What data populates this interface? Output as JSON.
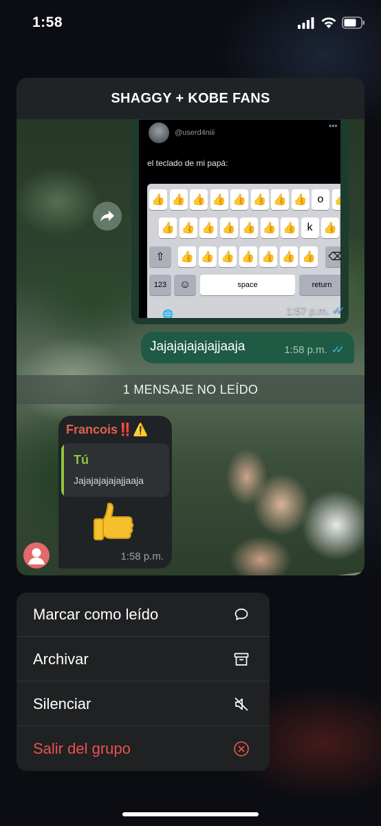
{
  "status_bar": {
    "time": "1:58"
  },
  "chat": {
    "title": "SHAGGY + KOBE FANS",
    "image_message": {
      "tweet_user": "@userd4niii",
      "tweet_text": "el teclado de mi papá:",
      "keyboard": {
        "row1": [
          "👍",
          "👍",
          "👍",
          "👍",
          "👍",
          "👍",
          "👍",
          "👍",
          "o",
          "👍"
        ],
        "row2": [
          "👍",
          "👍",
          "👍",
          "👍",
          "👍",
          "👍",
          "👍",
          "k",
          "👍"
        ],
        "row3": [
          "👍",
          "👍",
          "👍",
          "👍",
          "👍",
          "👍",
          "👍"
        ],
        "key_123": "123",
        "key_space": "space",
        "key_return": "return"
      },
      "time": "1:57 p.m."
    },
    "text_message": {
      "text": "Jajajajajajajjaaja",
      "time": "1:58 p.m."
    },
    "unread_banner": "1 MENSAJE NO LEÍDO",
    "incoming": {
      "sender": "Francois‼️⚠️",
      "quote_author": "Tú",
      "quote_text": "Jajajajajajajjaaja",
      "emoji": "thumbs-up",
      "time": "1:58 p.m."
    }
  },
  "menu": {
    "items": [
      {
        "label": "Marcar como leído",
        "icon": "chat-bubble-icon"
      },
      {
        "label": "Archivar",
        "icon": "archive-icon"
      },
      {
        "label": "Silenciar",
        "icon": "mute-icon"
      },
      {
        "label": "Salir del grupo",
        "icon": "leave-circle-x-icon",
        "color": "#e8524b"
      }
    ]
  },
  "colors": {
    "own_bubble": "#1f5a45",
    "incoming_bubble": "#202326",
    "sender_name": "#e0614d",
    "quote_accent": "#8ec63f",
    "read_ticks": "#4fb6ec",
    "danger": "#e8524b"
  }
}
